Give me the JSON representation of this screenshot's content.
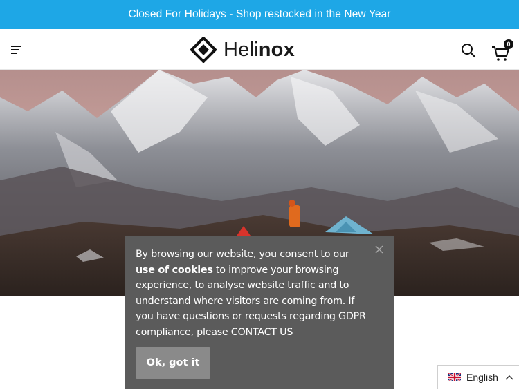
{
  "announcement": {
    "text": "Closed For Holidays - Shop restocked in the New Year"
  },
  "header": {
    "logo": {
      "text_light": "Heli",
      "text_bold": "nox"
    },
    "menu_icon": "hamburger-icon",
    "search_icon": "search-icon",
    "cart": {
      "icon": "cart-icon",
      "count": "0"
    }
  },
  "hero": {
    "image": "mountain-landscape-with-tents"
  },
  "cookie_banner": {
    "text_before": "By browsing our website, you consent to our ",
    "link_use_of_cookies": "use of cookies",
    "text_middle": " to improve your browsing experience, to analyse website traffic and to understand where visitors are coming from.  If you have questions or requests regarding GDPR compliance, please ",
    "link_contact": "CONTACT US",
    "ok_button": "Ok, got it",
    "close_icon": "close-icon"
  },
  "language_selector": {
    "flag_icon": "uk-flag-icon",
    "label": "English",
    "chevron": "chevron-up-icon"
  },
  "colors": {
    "announcement_bg": "#1ea7e6",
    "cookie_bg": "#5b5b5b",
    "ok_button_bg": "#8a8a8a"
  }
}
